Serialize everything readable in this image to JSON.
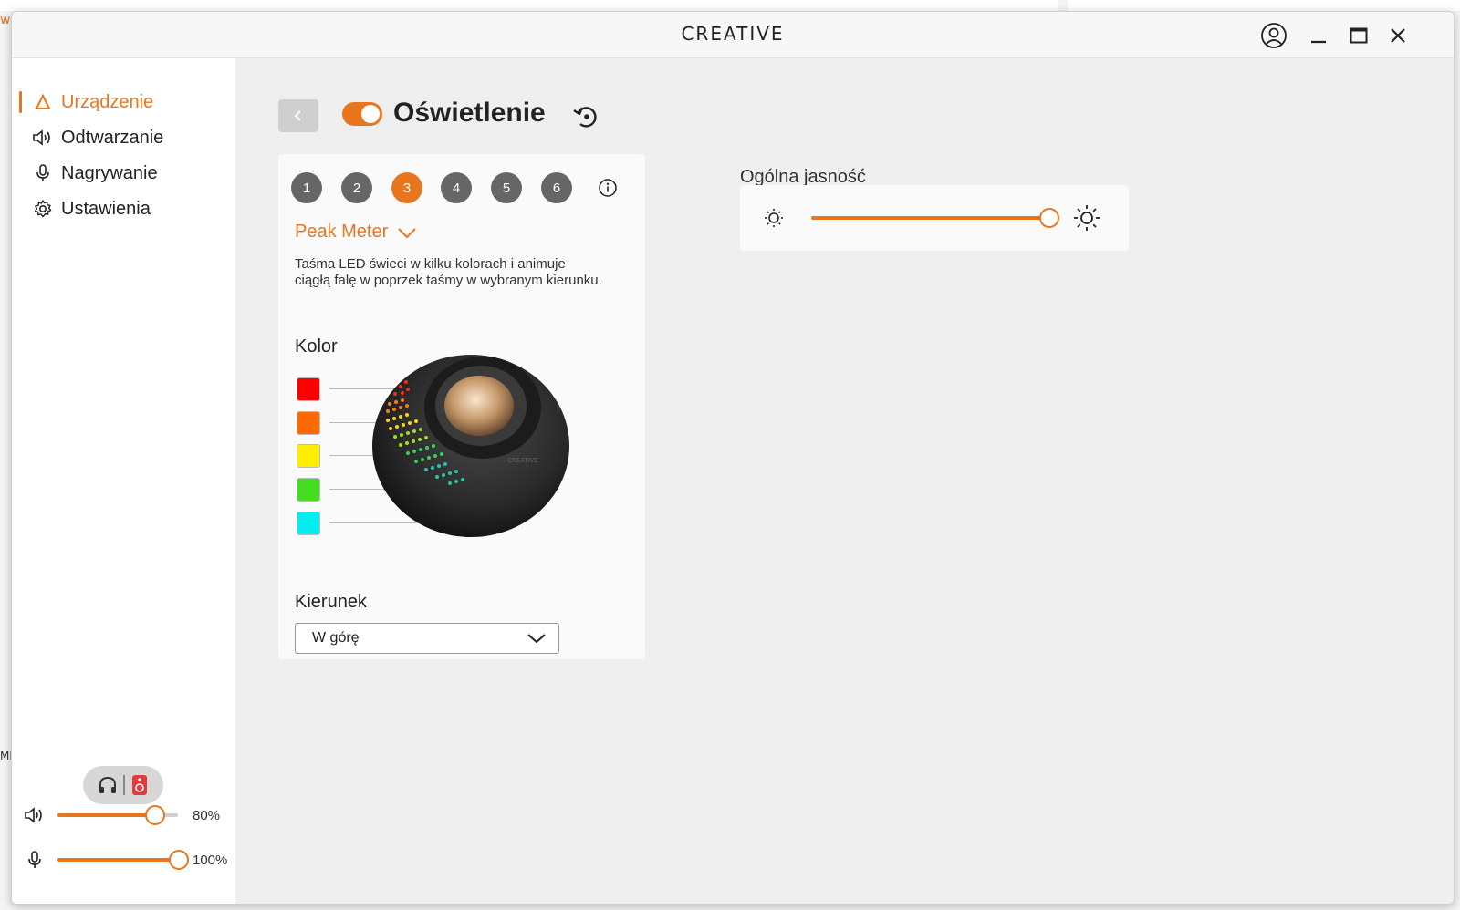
{
  "window": {
    "logo": "CREATIVE"
  },
  "background": {
    "left_fragment_top": "w",
    "left_fragment_mid": "MB"
  },
  "sidebar": {
    "items": [
      {
        "label": "Urządzenie",
        "icon": "device-icon",
        "active": true
      },
      {
        "label": "Odtwarzanie",
        "icon": "speaker-icon",
        "active": false
      },
      {
        "label": "Nagrywanie",
        "icon": "microphone-icon",
        "active": false
      },
      {
        "label": "Ustawienia",
        "icon": "gear-icon",
        "active": false
      }
    ],
    "output_toggle": {
      "left_icon": "headphones-icon",
      "right_icon": "speaker-device-icon"
    },
    "volume": {
      "playback_pct_label": "80%",
      "playback_value": 0.8,
      "mic_pct_label": "100%",
      "mic_value": 1.0
    }
  },
  "header": {
    "title": "Oświetlenie",
    "toggle_on": true
  },
  "lighting": {
    "presets": [
      "1",
      "2",
      "3",
      "4",
      "5",
      "6"
    ],
    "active_preset": 2,
    "effect": "Peak Meter",
    "description": "Taśma LED świeci w kilku kolorach i animuje ciągłą falę w poprzek taśmy w wybranym kierunku.",
    "color_label": "Kolor",
    "colors": [
      "#ff0000",
      "#ff6a00",
      "#ffee00",
      "#44dd22",
      "#00eeee"
    ],
    "direction_label": "Kierunek",
    "direction_value": "W górę"
  },
  "brightness": {
    "label": "Ogólna jasność",
    "value": 1.0
  },
  "accent": "#e8761e"
}
